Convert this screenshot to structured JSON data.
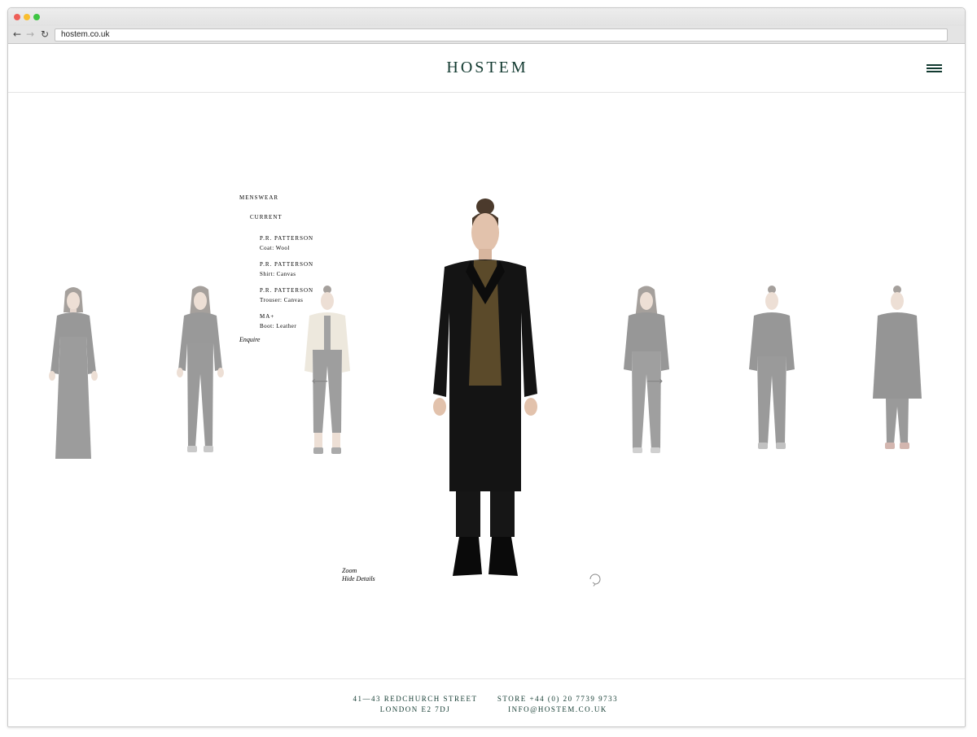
{
  "browser": {
    "url": "hostem.co.uk",
    "back_icon": "←",
    "forward_icon": "→",
    "reload_icon": "↻"
  },
  "header": {
    "logo": "HOSTEM",
    "menu_icon": "hamburger-menu-icon"
  },
  "navigation": {
    "category": "MENSWEAR",
    "subcategory": "CURRENT",
    "products": [
      {
        "brand": "P.R. PATTERSON",
        "item": "Coat: Wool"
      },
      {
        "brand": "P.R. PATTERSON",
        "item": "Shirt: Canvas"
      },
      {
        "brand": "P.R. PATTERSON",
        "item": "Trouser: Canvas"
      },
      {
        "brand": "MA+",
        "item": "Boot: Leather"
      }
    ],
    "enquire": "Enquire"
  },
  "viewer": {
    "prev_arrow": "⟵",
    "next_arrow": "⟶",
    "zoom": "Zoom",
    "hide_details": "Hide Details",
    "rotate_icon": "rotate-icon"
  },
  "footer": {
    "address_line1": "41—43 REDCHURCH STREET",
    "address_line2": "LONDON E2 7DJ",
    "store_phone": "STORE +44 (0) 20 7739 9733",
    "email": "INFO@HOSTEM.CO.UK"
  },
  "colors": {
    "brand": "#123a30",
    "text": "#1a1a1a",
    "border": "#e4e4e4"
  }
}
